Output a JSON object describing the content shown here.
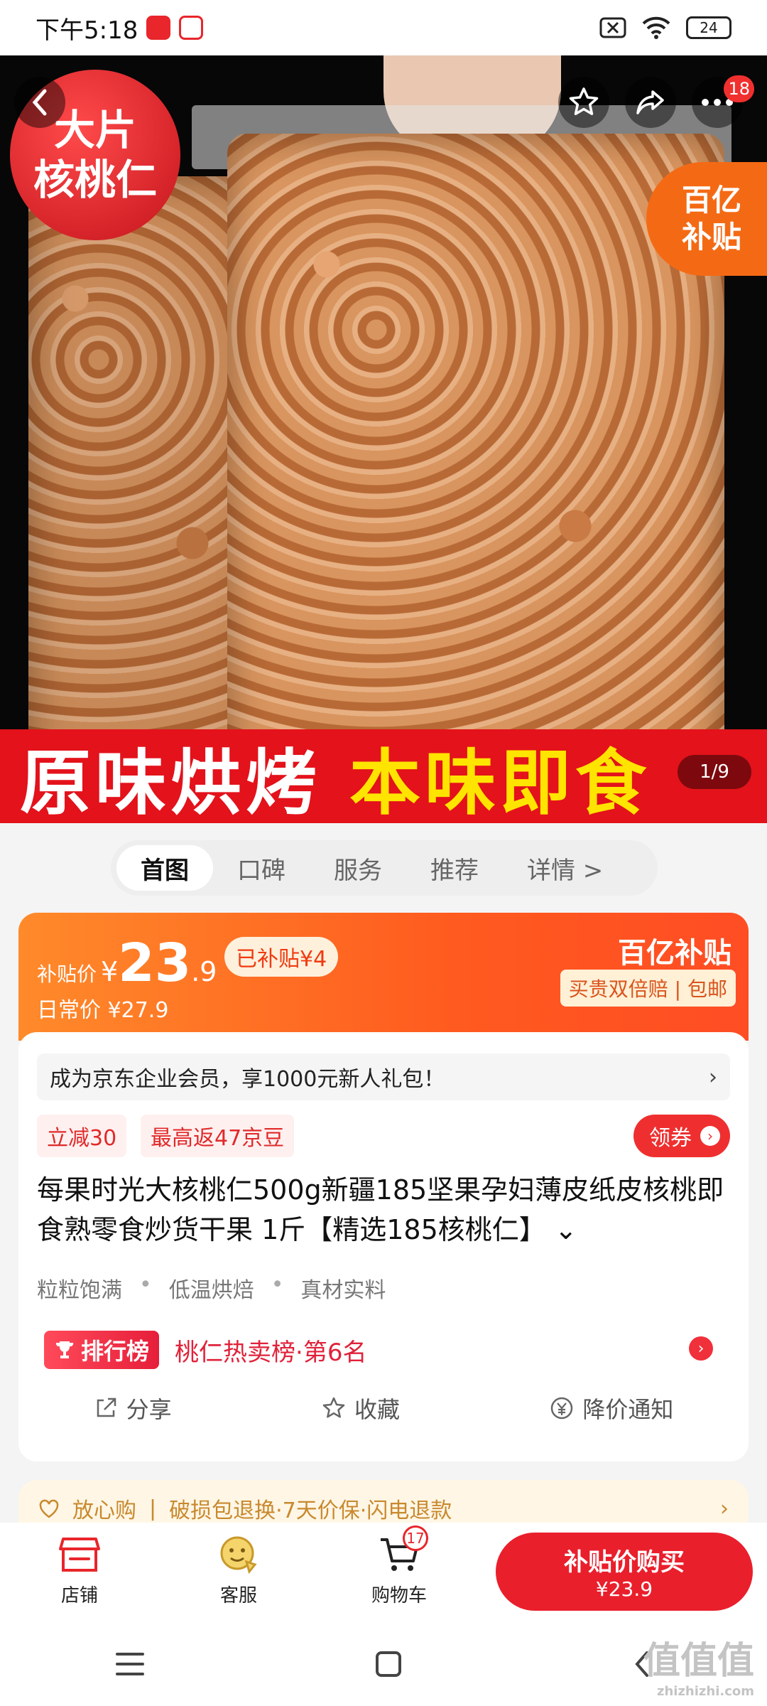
{
  "status": {
    "time": "下午5:18",
    "battery": "24"
  },
  "hero": {
    "disc_line1": "大片",
    "disc_line2": "核桃仁",
    "badge_line1": "百亿",
    "badge_line2": "补贴",
    "banner_white": "原味烘烤",
    "banner_yellow": "本味即食",
    "message_count": "18",
    "page_indicator": "1/9"
  },
  "tabs": [
    "首图",
    "口碑",
    "服务",
    "推荐",
    "详情 >"
  ],
  "price": {
    "label": "补贴价",
    "currency": "¥",
    "integer": "23",
    "decimal": ".9",
    "subsidized": "已补贴¥4",
    "daily": "日常价 ¥27.9",
    "logo": "百亿补贴",
    "tags": "买贵双倍赔 | 包邮"
  },
  "card": {
    "member": "成为京东企业会员，享1000元新人礼包！",
    "member_arrow": "›",
    "coupon1": "立减30",
    "coupon2": "最高返47京豆",
    "get_coupon": "领券",
    "title": "每果时光大核桃仁500g新疆185坚果孕妇薄皮纸皮核桃即食熟零食炒货干果 1斤【精选185核桃仁】 ⌄",
    "features": [
      "粒粒饱满",
      "低温烘焙",
      "真材实料"
    ],
    "rank_badge": "排行榜",
    "rank_text": "桃仁热卖榜·第6名",
    "actions": [
      "分享",
      "收藏",
      "降价通知"
    ]
  },
  "guarantee": {
    "label": "放心购",
    "text": "破损包退换·7天价保·闪电退款",
    "arrow": "›"
  },
  "bottom": {
    "shop": "店铺",
    "service": "客服",
    "cart": "购物车",
    "cart_count": "17",
    "buy_line1": "补贴价购买",
    "buy_line2": "¥23.9"
  },
  "watermark": {
    "main": "值值值",
    "sub": "zhizhizhi.com"
  },
  "colors": {
    "accent_red": "#ea1f2c",
    "subsidy_orange": "#ff5a1f"
  }
}
